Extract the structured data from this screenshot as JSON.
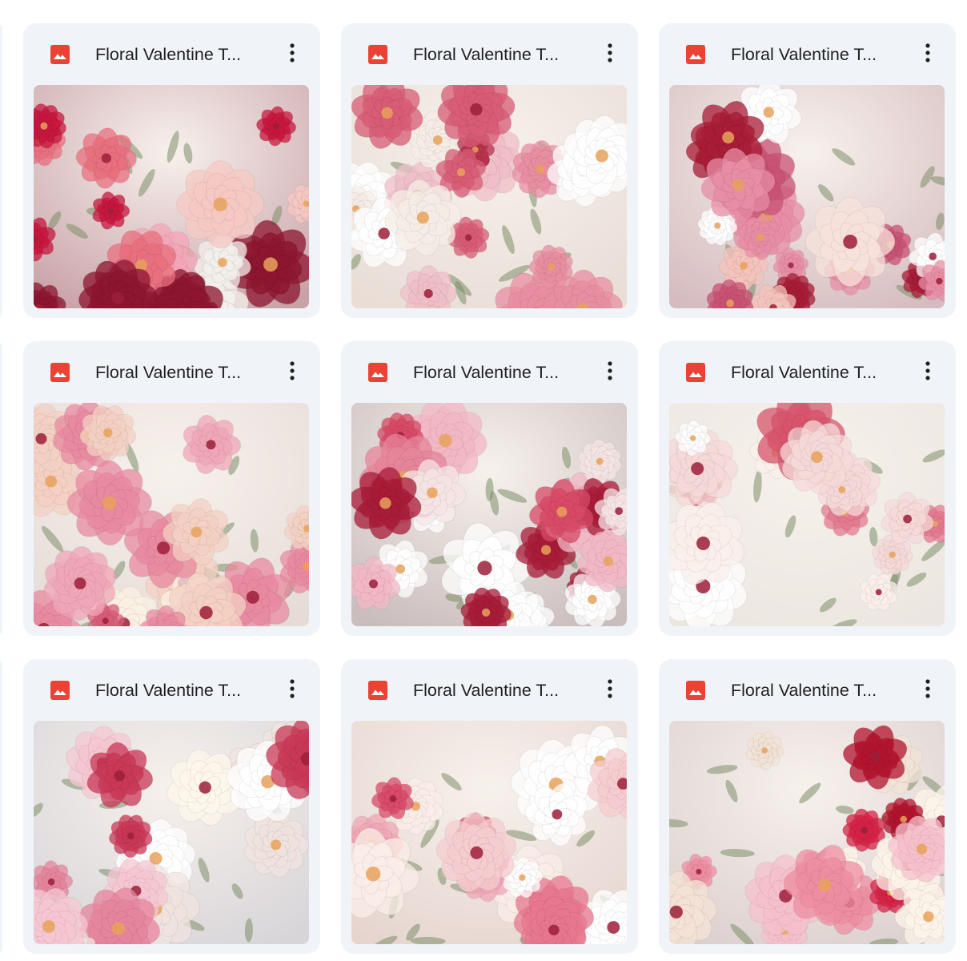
{
  "files": [
    {
      "name": "Floral Valentine T...",
      "icon": "image-file-icon",
      "palette": {
        "bg": "#c9a2a8",
        "colors": [
          "#c8173f",
          "#f4f0ec",
          "#f4a6b8",
          "#8d1530",
          "#e9707e",
          "#f7c9c4"
        ]
      }
    },
    {
      "name": "Floral Valentine T...",
      "icon": "image-file-icon",
      "palette": {
        "bg": "#e9ddd6",
        "colors": [
          "#f6eee6",
          "#d85c75",
          "#f0bfc8",
          "#b8344f",
          "#e98ea2",
          "#ffffff"
        ]
      }
    },
    {
      "name": "Floral Valentine T...",
      "icon": "image-file-icon",
      "palette": {
        "bg": "#d6bcc0",
        "colors": [
          "#c95274",
          "#f8e3dc",
          "#f5c4bb",
          "#a81c36",
          "#e88ea5",
          "#ffffff"
        ]
      }
    },
    {
      "name": "Floral Valentine T...",
      "icon": "image-file-icon",
      "palette": {
        "bg": "#e6dcd7",
        "colors": [
          "#f0a7b8",
          "#fbf1e4",
          "#d95d7a",
          "#f4d1c3",
          "#e98aa0",
          "#b43455"
        ]
      }
    },
    {
      "name": "Floral Valentine T...",
      "icon": "image-file-icon",
      "palette": {
        "bg": "#c9bdbd",
        "colors": [
          "#f6e5e5",
          "#d84a67",
          "#f3b8c6",
          "#a81c38",
          "#ffffff",
          "#e7859b"
        ]
      }
    },
    {
      "name": "Floral Valentine T...",
      "icon": "image-file-icon",
      "palette": {
        "bg": "#ece6e1",
        "colors": [
          "#f3c4cc",
          "#e57a90",
          "#fbf0ec",
          "#d8556c",
          "#f6dad9",
          "#ffffff"
        ]
      }
    },
    {
      "name": "Floral Valentine T...",
      "icon": "image-file-icon",
      "palette": {
        "bg": "#d8d5d9",
        "colors": [
          "#f6c7d2",
          "#fdf7ec",
          "#e6859d",
          "#c93857",
          "#f1e4df",
          "#ffffff"
        ]
      }
    },
    {
      "name": "Floral Valentine T...",
      "icon": "image-file-icon",
      "palette": {
        "bg": "#e6d5cf",
        "colors": [
          "#f0a7b5",
          "#ffffff",
          "#d94b6a",
          "#f6cdd0",
          "#e8778f",
          "#fbeee8"
        ]
      }
    },
    {
      "name": "Floral Valentine T...",
      "icon": "image-file-icon",
      "palette": {
        "bg": "#dcd0cf",
        "colors": [
          "#d52346",
          "#f7c1cc",
          "#fdf5ea",
          "#b2142e",
          "#ef8ea3",
          "#f4e3d6"
        ]
      }
    }
  ],
  "colors": {
    "card_bg": "#f0f4f9",
    "image_icon": "#ea4335",
    "text": "#1f1f1f"
  }
}
